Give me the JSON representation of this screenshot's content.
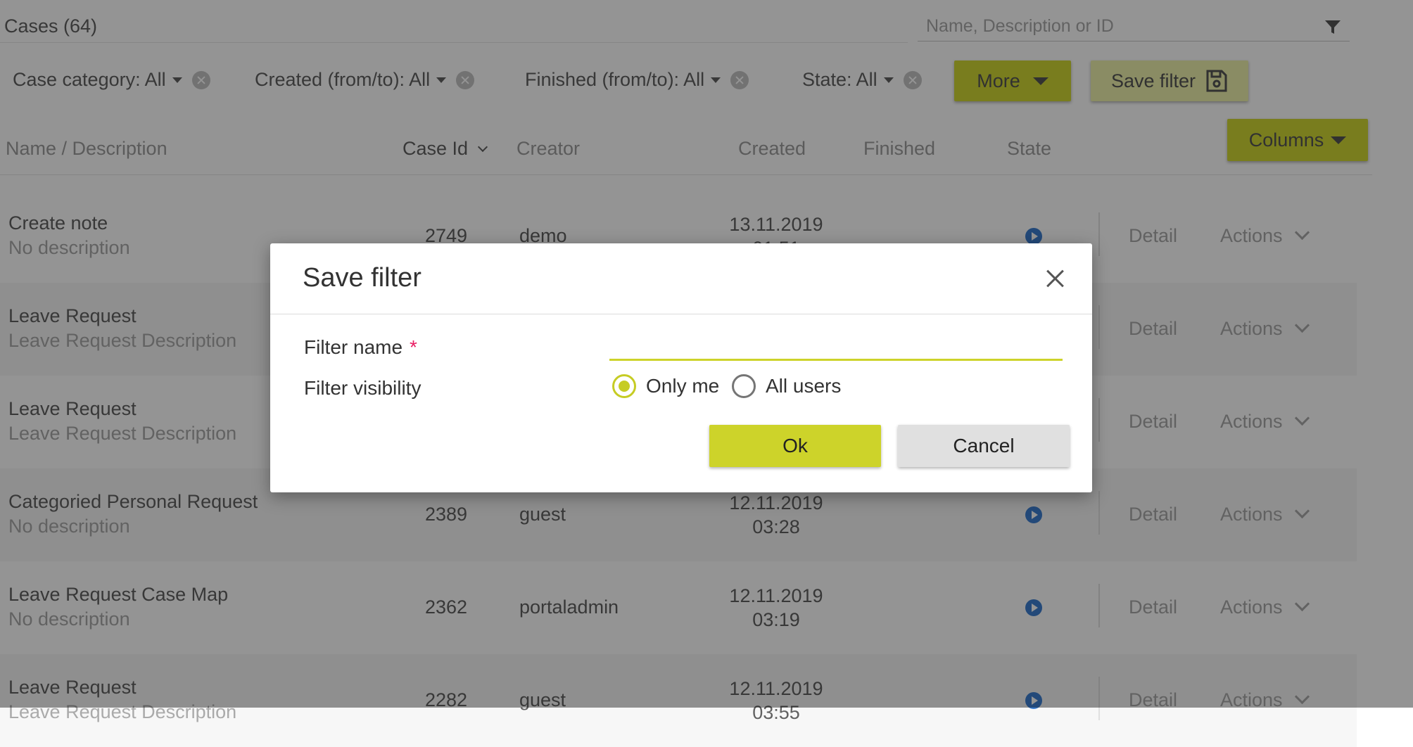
{
  "page": {
    "title": "Cases (64)",
    "search_placeholder": "Name, Description or ID"
  },
  "filters": [
    {
      "label": "Case category: All"
    },
    {
      "label": "Created (from/to): All"
    },
    {
      "label": "Finished (from/to): All"
    },
    {
      "label": "State: All"
    }
  ],
  "toolbar": {
    "more_label": "More",
    "save_filter_label": "Save filter",
    "columns_label": "Columns"
  },
  "columns": {
    "name": "Name / Description",
    "case_id": "Case Id",
    "creator": "Creator",
    "created": "Created",
    "finished": "Finished",
    "state": "State"
  },
  "rows": [
    {
      "name": "Create note",
      "desc": "No description",
      "id": "2749",
      "creator": "demo",
      "date": "13.11.2019",
      "time": "01:51"
    },
    {
      "name": "Leave Request",
      "desc": "Leave Request Description",
      "id": "",
      "creator": "",
      "date": "",
      "time": ""
    },
    {
      "name": "Leave Request",
      "desc": "Leave Request Description",
      "id": "",
      "creator": "",
      "date": "",
      "time": ""
    },
    {
      "name": "Categoried Personal Request",
      "desc": "No description",
      "id": "2389",
      "creator": "guest",
      "date": "12.11.2019",
      "time": "03:28"
    },
    {
      "name": "Leave Request Case Map",
      "desc": "No description",
      "id": "2362",
      "creator": "portaladmin",
      "date": "12.11.2019",
      "time": "03:19"
    },
    {
      "name": "Leave Request",
      "desc": "Leave Request Description",
      "id": "2282",
      "creator": "guest",
      "date": "12.11.2019",
      "time": "03:55"
    }
  ],
  "row_actions": {
    "detail": "Detail",
    "actions": "Actions"
  },
  "dialog": {
    "title": "Save filter",
    "filter_name_label": "Filter name",
    "required_mark": "*",
    "filter_name_value": "",
    "visibility_label": "Filter visibility",
    "options": [
      {
        "label": "Only me",
        "selected": true
      },
      {
        "label": "All users",
        "selected": false
      }
    ],
    "ok_label": "Ok",
    "cancel_label": "Cancel"
  },
  "colors": {
    "accent": "#cdd32a",
    "required": "#e91e63",
    "state_running": "#3d7fd1"
  }
}
